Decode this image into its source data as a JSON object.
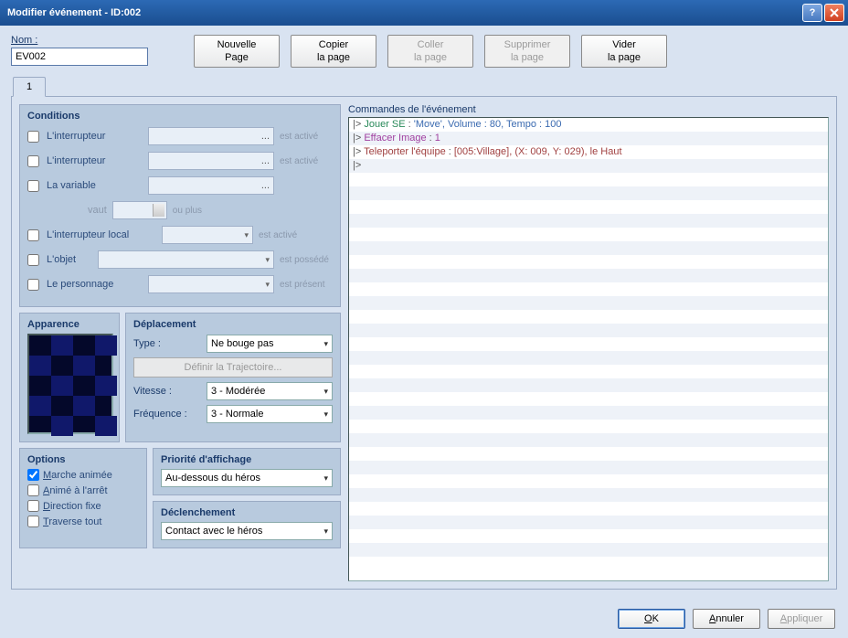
{
  "window": {
    "title": "Modifier événement - ID:002"
  },
  "nom": {
    "label": "Nom :",
    "value": "EV002"
  },
  "page_buttons": {
    "new": {
      "line1": "Nouvelle",
      "line2": "Page"
    },
    "copy": {
      "line1": "Copier",
      "line2": "la page"
    },
    "paste": {
      "line1": "Coller",
      "line2": "la page"
    },
    "delete": {
      "line1": "Supprimer",
      "line2": "la page"
    },
    "clear": {
      "line1": "Vider",
      "line2": "la page"
    }
  },
  "tabs": {
    "tab1": "1"
  },
  "conditions": {
    "title": "Conditions",
    "switch1_label": "L'interrupteur",
    "switch1_field": "...",
    "switch1_suffix": "est activé",
    "switch2_label": "L'interrupteur",
    "switch2_field": "...",
    "switch2_suffix": "est activé",
    "variable_label": "La variable",
    "variable_field": "...",
    "vaut_label": "vaut",
    "vaut_suffix": "ou plus",
    "selfswitch_label": "L'interrupteur local",
    "selfswitch_suffix": "est activé",
    "item_label": "L'objet",
    "item_suffix": "est possédé",
    "actor_label": "Le personnage",
    "actor_suffix": "est présent"
  },
  "appearance": {
    "title": "Apparence"
  },
  "movement": {
    "title": "Déplacement",
    "type_label": "Type :",
    "type_value": "Ne bouge pas",
    "traj_button": "Définir la Trajectoire...",
    "speed_label": "Vitesse :",
    "speed_value": "3 - Modérée",
    "freq_label": "Fréquence :",
    "freq_value": "3 - Normale"
  },
  "options": {
    "title": "Options",
    "walk_anim": "arche animée",
    "walk_anim_u": "M",
    "step_anim": "nimé à l'arrêt",
    "step_anim_u": "A",
    "dir_fix": "irection fixe",
    "dir_fix_u": "D",
    "through": "raverse tout",
    "through_u": "T"
  },
  "priority": {
    "title": "Priorité d'affichage",
    "value": "Au-dessous du héros"
  },
  "trigger": {
    "title": "Déclenchement",
    "value": "Contact avec le héros"
  },
  "commands": {
    "title": "Commandes de l'événement",
    "lines": [
      {
        "prefix": "|> ",
        "segments": [
          {
            "t": "Jouer SE",
            "c": "tok-cmd1"
          },
          {
            "t": " : ",
            "c": "tok-prefix"
          },
          {
            "t": "'Move', Volume : 80, Tempo : 100",
            "c": "tok-param"
          }
        ]
      },
      {
        "prefix": "|> ",
        "segments": [
          {
            "t": "Effacer Image",
            "c": "tok-cmd2"
          },
          {
            "t": " : ",
            "c": "tok-prefix"
          },
          {
            "t": "1",
            "c": "tok-num"
          }
        ]
      },
      {
        "prefix": "|> ",
        "segments": [
          {
            "t": "Teleporter l'équipe",
            "c": "tok-tel"
          },
          {
            "t": " : ",
            "c": "tok-prefix"
          },
          {
            "t": "[005:Village], (X: 009, Y: 029), le Haut",
            "c": "tok-tel"
          }
        ]
      },
      {
        "prefix": "|>",
        "segments": []
      }
    ]
  },
  "buttons": {
    "ok": "K",
    "ok_u": "O",
    "cancel": "nnuler",
    "cancel_u": "A",
    "apply": "ppliquer",
    "apply_u": "A"
  }
}
